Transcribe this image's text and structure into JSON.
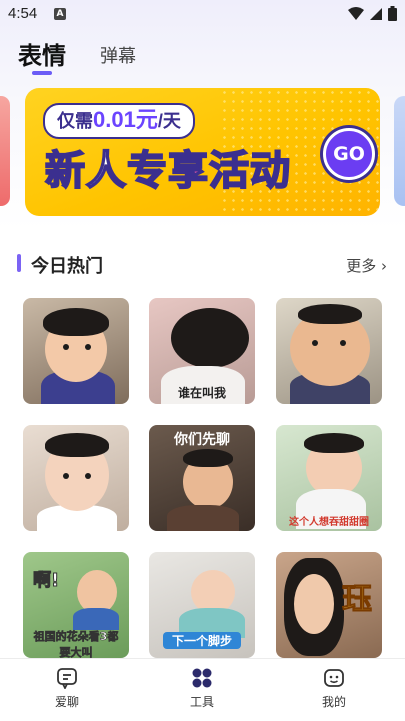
{
  "status_bar": {
    "time": "4:54",
    "notification_letter": "A"
  },
  "tabs": [
    {
      "label": "表情",
      "active": true
    },
    {
      "label": "弹幕",
      "active": false
    }
  ],
  "banner": {
    "pill_text_prefix": "仅需",
    "pill_price": "0.01元",
    "pill_suffix": "/天",
    "title_a": "新人",
    "title_b": "专享活动",
    "go_label": "GO"
  },
  "section": {
    "title": "今日热门",
    "more_label": "更多 ›"
  },
  "grid": [
    {
      "caption": ""
    },
    {
      "caption": "谁在叫我"
    },
    {
      "caption": ""
    },
    {
      "caption": ""
    },
    {
      "caption": "你们先聊"
    },
    {
      "caption": "这个人想吞甜甜圈"
    },
    {
      "caption_top": "啊!",
      "caption": "祖国的花朵看3都要大叫"
    },
    {
      "caption": "下一个脚步"
    },
    {
      "caption": "珏"
    }
  ],
  "bottom_nav": [
    {
      "label": "爱聊",
      "icon": "chat-icon",
      "active": false
    },
    {
      "label": "工具",
      "icon": "grid-dots-icon",
      "active": true
    },
    {
      "label": "我的",
      "icon": "profile-icon",
      "active": false
    }
  ],
  "colors": {
    "accent": "#6b5cf6",
    "banner_yellow": "#ffc400",
    "banner_purple": "#3b2f8f"
  }
}
